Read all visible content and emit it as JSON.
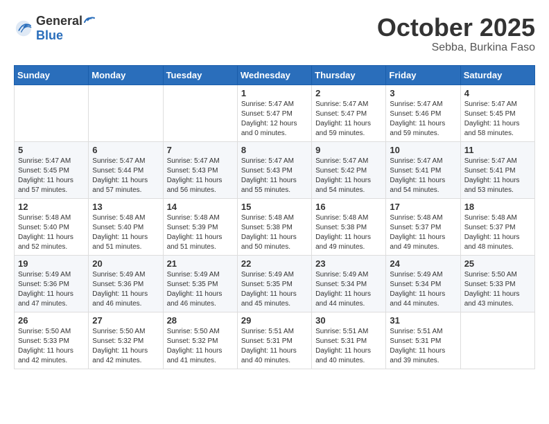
{
  "header": {
    "logo_general": "General",
    "logo_blue": "Blue",
    "month": "October 2025",
    "location": "Sebba, Burkina Faso"
  },
  "weekdays": [
    "Sunday",
    "Monday",
    "Tuesday",
    "Wednesday",
    "Thursday",
    "Friday",
    "Saturday"
  ],
  "weeks": [
    [
      {
        "day": "",
        "sunrise": "",
        "sunset": "",
        "daylight": ""
      },
      {
        "day": "",
        "sunrise": "",
        "sunset": "",
        "daylight": ""
      },
      {
        "day": "",
        "sunrise": "",
        "sunset": "",
        "daylight": ""
      },
      {
        "day": "1",
        "sunrise": "Sunrise: 5:47 AM",
        "sunset": "Sunset: 5:47 PM",
        "daylight": "Daylight: 12 hours and 0 minutes."
      },
      {
        "day": "2",
        "sunrise": "Sunrise: 5:47 AM",
        "sunset": "Sunset: 5:47 PM",
        "daylight": "Daylight: 11 hours and 59 minutes."
      },
      {
        "day": "3",
        "sunrise": "Sunrise: 5:47 AM",
        "sunset": "Sunset: 5:46 PM",
        "daylight": "Daylight: 11 hours and 59 minutes."
      },
      {
        "day": "4",
        "sunrise": "Sunrise: 5:47 AM",
        "sunset": "Sunset: 5:45 PM",
        "daylight": "Daylight: 11 hours and 58 minutes."
      }
    ],
    [
      {
        "day": "5",
        "sunrise": "Sunrise: 5:47 AM",
        "sunset": "Sunset: 5:45 PM",
        "daylight": "Daylight: 11 hours and 57 minutes."
      },
      {
        "day": "6",
        "sunrise": "Sunrise: 5:47 AM",
        "sunset": "Sunset: 5:44 PM",
        "daylight": "Daylight: 11 hours and 57 minutes."
      },
      {
        "day": "7",
        "sunrise": "Sunrise: 5:47 AM",
        "sunset": "Sunset: 5:43 PM",
        "daylight": "Daylight: 11 hours and 56 minutes."
      },
      {
        "day": "8",
        "sunrise": "Sunrise: 5:47 AM",
        "sunset": "Sunset: 5:43 PM",
        "daylight": "Daylight: 11 hours and 55 minutes."
      },
      {
        "day": "9",
        "sunrise": "Sunrise: 5:47 AM",
        "sunset": "Sunset: 5:42 PM",
        "daylight": "Daylight: 11 hours and 54 minutes."
      },
      {
        "day": "10",
        "sunrise": "Sunrise: 5:47 AM",
        "sunset": "Sunset: 5:41 PM",
        "daylight": "Daylight: 11 hours and 54 minutes."
      },
      {
        "day": "11",
        "sunrise": "Sunrise: 5:47 AM",
        "sunset": "Sunset: 5:41 PM",
        "daylight": "Daylight: 11 hours and 53 minutes."
      }
    ],
    [
      {
        "day": "12",
        "sunrise": "Sunrise: 5:48 AM",
        "sunset": "Sunset: 5:40 PM",
        "daylight": "Daylight: 11 hours and 52 minutes."
      },
      {
        "day": "13",
        "sunrise": "Sunrise: 5:48 AM",
        "sunset": "Sunset: 5:40 PM",
        "daylight": "Daylight: 11 hours and 51 minutes."
      },
      {
        "day": "14",
        "sunrise": "Sunrise: 5:48 AM",
        "sunset": "Sunset: 5:39 PM",
        "daylight": "Daylight: 11 hours and 51 minutes."
      },
      {
        "day": "15",
        "sunrise": "Sunrise: 5:48 AM",
        "sunset": "Sunset: 5:38 PM",
        "daylight": "Daylight: 11 hours and 50 minutes."
      },
      {
        "day": "16",
        "sunrise": "Sunrise: 5:48 AM",
        "sunset": "Sunset: 5:38 PM",
        "daylight": "Daylight: 11 hours and 49 minutes."
      },
      {
        "day": "17",
        "sunrise": "Sunrise: 5:48 AM",
        "sunset": "Sunset: 5:37 PM",
        "daylight": "Daylight: 11 hours and 49 minutes."
      },
      {
        "day": "18",
        "sunrise": "Sunrise: 5:48 AM",
        "sunset": "Sunset: 5:37 PM",
        "daylight": "Daylight: 11 hours and 48 minutes."
      }
    ],
    [
      {
        "day": "19",
        "sunrise": "Sunrise: 5:49 AM",
        "sunset": "Sunset: 5:36 PM",
        "daylight": "Daylight: 11 hours and 47 minutes."
      },
      {
        "day": "20",
        "sunrise": "Sunrise: 5:49 AM",
        "sunset": "Sunset: 5:36 PM",
        "daylight": "Daylight: 11 hours and 46 minutes."
      },
      {
        "day": "21",
        "sunrise": "Sunrise: 5:49 AM",
        "sunset": "Sunset: 5:35 PM",
        "daylight": "Daylight: 11 hours and 46 minutes."
      },
      {
        "day": "22",
        "sunrise": "Sunrise: 5:49 AM",
        "sunset": "Sunset: 5:35 PM",
        "daylight": "Daylight: 11 hours and 45 minutes."
      },
      {
        "day": "23",
        "sunrise": "Sunrise: 5:49 AM",
        "sunset": "Sunset: 5:34 PM",
        "daylight": "Daylight: 11 hours and 44 minutes."
      },
      {
        "day": "24",
        "sunrise": "Sunrise: 5:49 AM",
        "sunset": "Sunset: 5:34 PM",
        "daylight": "Daylight: 11 hours and 44 minutes."
      },
      {
        "day": "25",
        "sunrise": "Sunrise: 5:50 AM",
        "sunset": "Sunset: 5:33 PM",
        "daylight": "Daylight: 11 hours and 43 minutes."
      }
    ],
    [
      {
        "day": "26",
        "sunrise": "Sunrise: 5:50 AM",
        "sunset": "Sunset: 5:33 PM",
        "daylight": "Daylight: 11 hours and 42 minutes."
      },
      {
        "day": "27",
        "sunrise": "Sunrise: 5:50 AM",
        "sunset": "Sunset: 5:32 PM",
        "daylight": "Daylight: 11 hours and 42 minutes."
      },
      {
        "day": "28",
        "sunrise": "Sunrise: 5:50 AM",
        "sunset": "Sunset: 5:32 PM",
        "daylight": "Daylight: 11 hours and 41 minutes."
      },
      {
        "day": "29",
        "sunrise": "Sunrise: 5:51 AM",
        "sunset": "Sunset: 5:31 PM",
        "daylight": "Daylight: 11 hours and 40 minutes."
      },
      {
        "day": "30",
        "sunrise": "Sunrise: 5:51 AM",
        "sunset": "Sunset: 5:31 PM",
        "daylight": "Daylight: 11 hours and 40 minutes."
      },
      {
        "day": "31",
        "sunrise": "Sunrise: 5:51 AM",
        "sunset": "Sunset: 5:31 PM",
        "daylight": "Daylight: 11 hours and 39 minutes."
      },
      {
        "day": "",
        "sunrise": "",
        "sunset": "",
        "daylight": ""
      }
    ]
  ]
}
